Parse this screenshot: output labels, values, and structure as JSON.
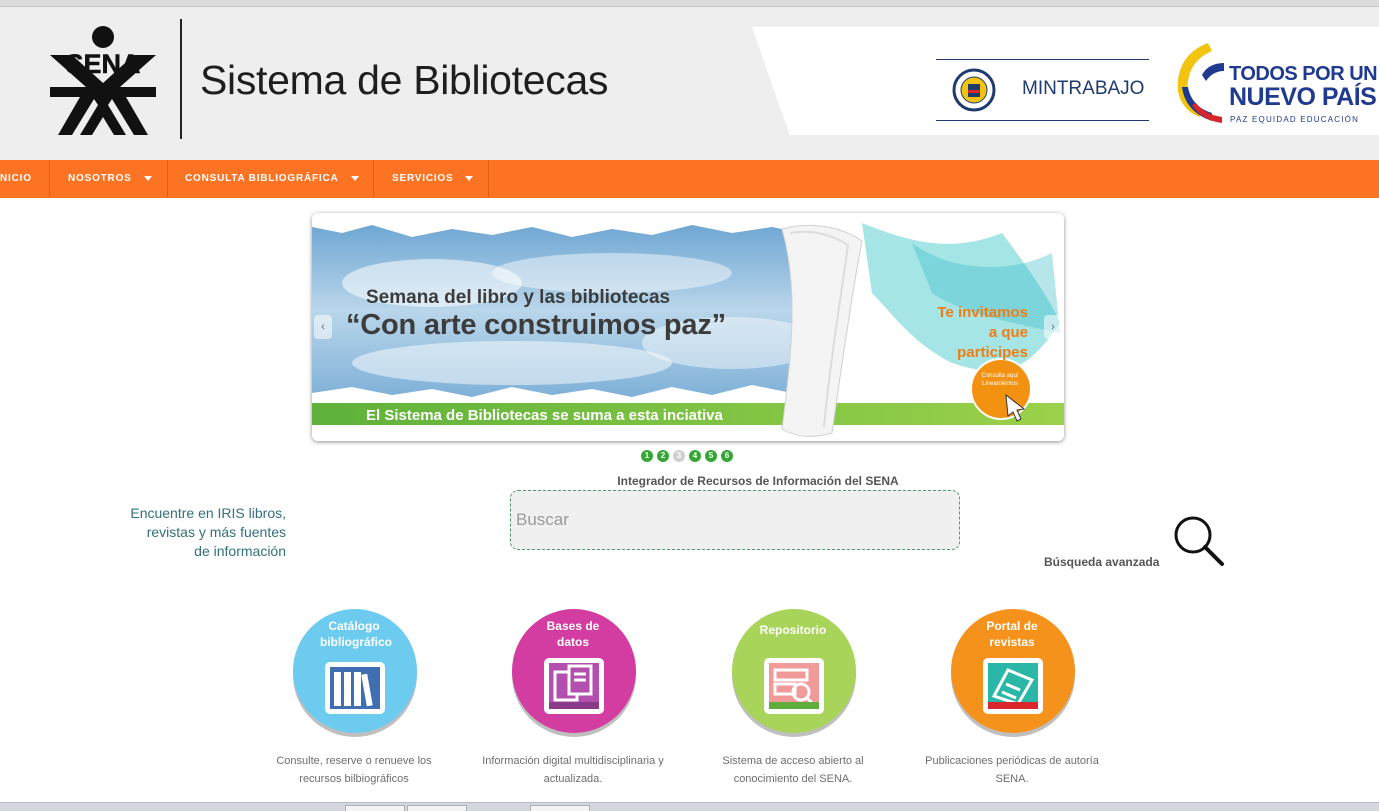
{
  "header": {
    "site_title": "Sistema de Bibliotecas",
    "logo_text": "SENA",
    "ministry": "MINTRABAJO",
    "campaign_line1": "TODOS POR UN",
    "campaign_line2": "NUEVO PAÍS",
    "campaign_tagline": "PAZ  EQUIDAD  EDUCACIÓN"
  },
  "nav": {
    "items": [
      {
        "label": "NICIO",
        "has_dropdown": false
      },
      {
        "label": "NOSOTROS",
        "has_dropdown": true
      },
      {
        "label": "CONSULTA BIBLIOGRÁFICA",
        "has_dropdown": true
      },
      {
        "label": "SERVICIOS",
        "has_dropdown": true
      }
    ]
  },
  "banner": {
    "line1": "Semana del libro y las bibliotecas",
    "line2": "“Con arte construimos paz”",
    "footer": "El Sistema de Bibliotecas se suma a esta inciativa",
    "invite": "Te invitamos a que participes",
    "button": "Consulta aquí Lineamientos",
    "prev": "‹",
    "next": "›",
    "slides": [
      "1",
      "2",
      "3",
      "4",
      "5",
      "6"
    ],
    "active_slide": 3
  },
  "search": {
    "caption": "Encuentre en IRIS libros, revistas y más fuentes de información",
    "label": "Integrador de Recursos de Información del SENA",
    "placeholder": "Buscar",
    "value": "",
    "advanced": "Búsqueda avanzada"
  },
  "services": [
    {
      "title": "Catálogo bibliográfico",
      "description": "Consulte, reserve o renueve los recursos bilbiográficos",
      "color": "#6ecbf0",
      "icon": "bookshelf-icon"
    },
    {
      "title": "Bases de datos",
      "description": "Información digital multidisciplinaria y actualizada.",
      "color": "#d33da1",
      "icon": "database-icon"
    },
    {
      "title": "Repositorio",
      "description": "Sistema de acceso abierto al conocimiento del SENA.",
      "color": "#a8d45a",
      "icon": "repository-search-icon"
    },
    {
      "title": "Portal de revistas",
      "description": "Publicaciones periódicas de autoría SENA.",
      "color": "#f4921c",
      "icon": "magazines-icon"
    }
  ]
}
